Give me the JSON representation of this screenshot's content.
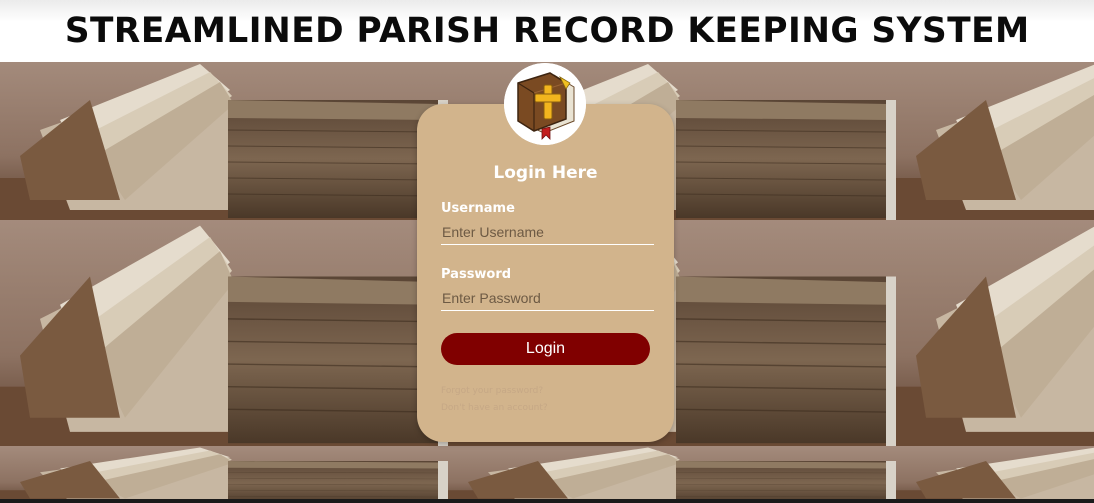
{
  "header": {
    "title": "STREAMLINED PARISH RECORD KEEPING SYSTEM"
  },
  "login": {
    "title": "Login Here",
    "username_label": "Username",
    "username_placeholder": "Enter Username",
    "username_value": "",
    "password_label": "Password",
    "password_placeholder": "Enter Password",
    "password_value": "",
    "submit_label": "Login",
    "forgot_link": "Forgot your password?",
    "signup_link": "Don't have an account?"
  },
  "icons": {
    "logo": "holy-bible-cross-icon"
  },
  "colors": {
    "card_background": "#d2b48c",
    "button_background": "#800000",
    "button_text": "#ffffff",
    "header_background": "#ffffff",
    "header_text": "#0b0b0b"
  }
}
